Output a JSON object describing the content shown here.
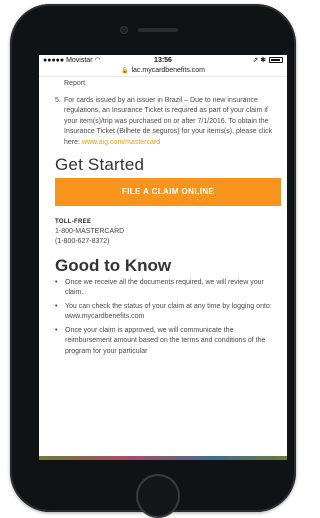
{
  "status_bar": {
    "carrier": "●●●●● Movistar",
    "time": "13:56",
    "indicators": "⇗ ✱"
  },
  "url_bar": {
    "url": "lac.mycardbenefits.com"
  },
  "content": {
    "report_line": "Report.",
    "item5": {
      "number": "5.",
      "text": "For cards issued by an issuer in Brazil – Due to new insurance regulations, an Insurance Ticket is required as part of your claim if your item(s)/trip was purchased on or after 7/1/2016. To obtain the Insurance Ticket (Bilhete de seguros) for your items(s), please click here:",
      "link": "www.aig.com/mastercard"
    },
    "get_started": {
      "title": "Get Started",
      "button": "FILE A CLAIM ONLINE",
      "tollfree_label": "TOLL-FREE",
      "phone_text": "1-800-MASTERCARD",
      "phone_number": "(1-800-627-8372)"
    },
    "good_to_know": {
      "title": "Good to Know",
      "bullets": [
        "Once we receive all the documents required, we will review your claim.",
        "You can check the status of your claim at any time by logging onto: www.mycardbenefits.com",
        "Once your claim is approved, we will communicate the reimbursement amount based on the terms and conditions of the program for your particular"
      ]
    }
  },
  "colors": {
    "accent": "#f7941d",
    "link": "#f39c12",
    "device": "#111214"
  }
}
